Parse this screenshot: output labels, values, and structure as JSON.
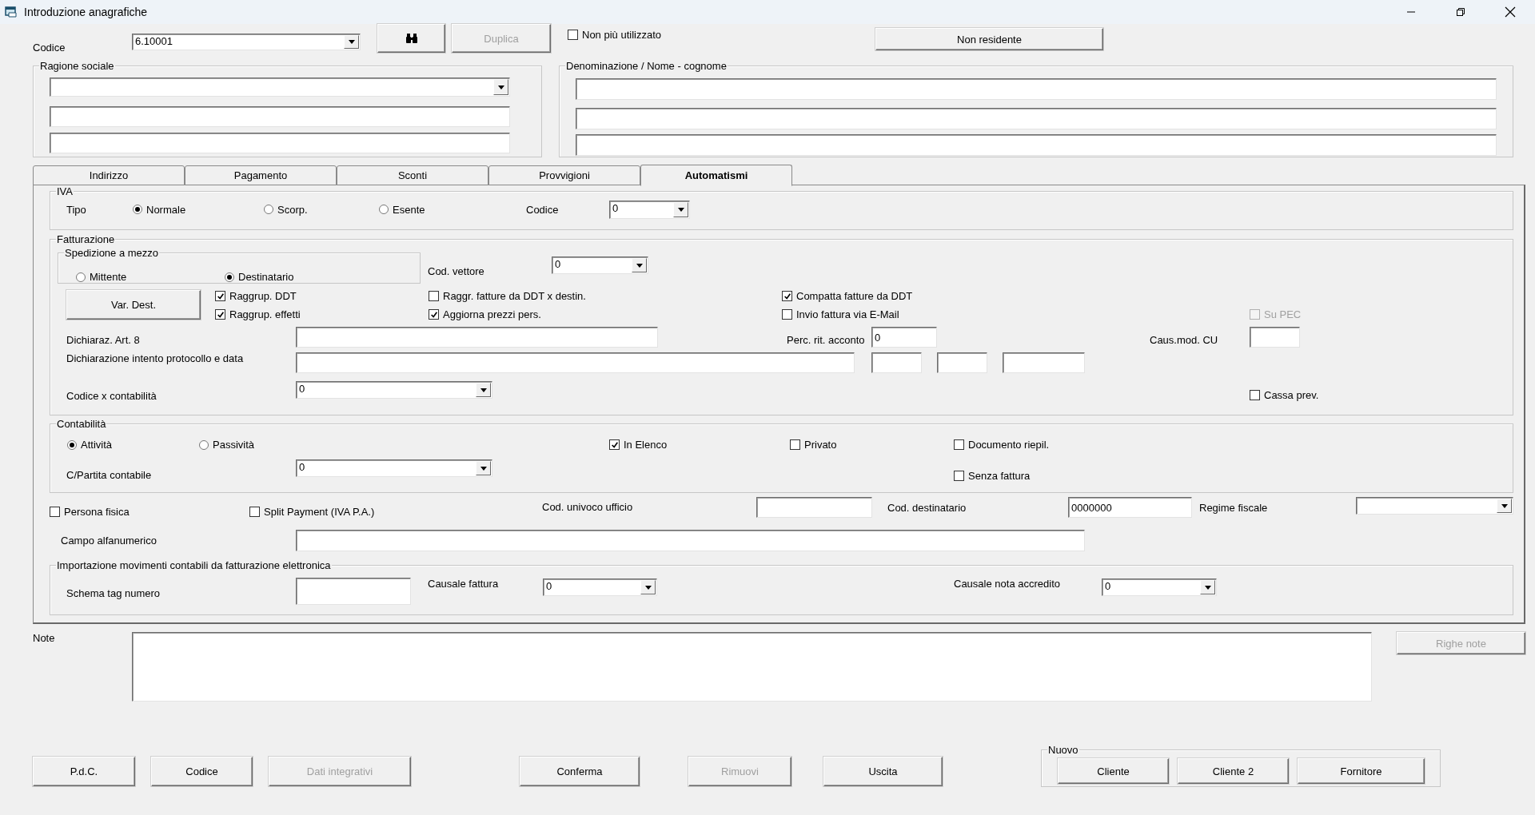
{
  "window": {
    "title": "Introduzione anagrafiche"
  },
  "header": {
    "codice_label": "Codice",
    "codice_value": "6.10001",
    "duplica": {
      "label": "Duplica",
      "disabled": true
    },
    "non_piu_utilizzato": {
      "label": "Non più utilizzato",
      "checked": false
    },
    "non_residente": "Non residente"
  },
  "ragione_sociale": {
    "title": "Ragione sociale"
  },
  "denominazione": {
    "title": "Denominazione / Nome - cognome"
  },
  "tabs": [
    {
      "label": "Indirizzo",
      "selected": false
    },
    {
      "label": "Pagamento",
      "selected": false
    },
    {
      "label": "Sconti",
      "selected": false
    },
    {
      "label": "Provvigioni",
      "selected": false
    },
    {
      "label": "Automatismi",
      "selected": true
    }
  ],
  "iva": {
    "title": "IVA",
    "tipo_label": "Tipo",
    "options": [
      {
        "label": "Normale",
        "selected": true
      },
      {
        "label": "Scorp.",
        "selected": false
      },
      {
        "label": "Esente",
        "selected": false
      }
    ],
    "codice_label": "Codice",
    "codice_value": "0"
  },
  "fatturazione": {
    "title": "Fatturazione",
    "spedizione": {
      "title": "Spedizione a mezzo",
      "options": [
        {
          "label": "Mittente",
          "selected": false
        },
        {
          "label": "Destinatario",
          "selected": true
        }
      ]
    },
    "cod_vettore_label": "Cod. vettore",
    "cod_vettore_value": "0",
    "var_dest": "Var. Dest.",
    "raggrup_ddt": {
      "label": "Raggrup. DDT",
      "checked": true
    },
    "raggrup_effetti": {
      "label": "Raggrup. effetti",
      "checked": true
    },
    "raggr_fatture": {
      "label": "Raggr. fatture da DDT x destin.",
      "checked": false
    },
    "aggiorna_prezzi": {
      "label": "Aggiorna prezzi pers.",
      "checked": true
    },
    "compatta_fatture": {
      "label": "Compatta fatture da DDT",
      "checked": true
    },
    "invio_email": {
      "label": "Invio fattura via E-Mail",
      "checked": false
    },
    "su_pec": {
      "label": "Su PEC",
      "checked": false,
      "disabled": true
    },
    "dichiaraz_label": "Dichiaraz. Art. 8",
    "perc_label": "Perc. rit. acconto",
    "perc_value": "0",
    "caus_label": "Caus.mod. CU",
    "intento_label": "Dichiarazione intento protocollo e data",
    "codice_contab_label": "Codice x contabilità",
    "codice_contab_value": "0",
    "cassa_prev": {
      "label": "Cassa prev.",
      "checked": false
    }
  },
  "contabilita": {
    "title": "Contabilità",
    "options": [
      {
        "label": "Attività",
        "selected": true
      },
      {
        "label": "Passività",
        "selected": false
      }
    ],
    "in_elenco": {
      "label": "In Elenco",
      "checked": true
    },
    "privato": {
      "label": "Privato",
      "checked": false
    },
    "documento_riepil": {
      "label": "Documento riepil.",
      "checked": false
    },
    "senza_fattura": {
      "label": "Senza fattura",
      "checked": false
    },
    "partita_label": "C/Partita contabile",
    "partita_value": "0"
  },
  "persona_fisica": {
    "label": "Persona fisica",
    "checked": false
  },
  "split_payment": {
    "label": "Split Payment (IVA P.A.)",
    "checked": false
  },
  "cod_univoco_label": "Cod. univoco ufficio",
  "cod_destinatario_label": "Cod. destinatario",
  "cod_destinatario_value": "0000000",
  "regime_fiscale_label": "Regime fiscale",
  "campo_label": "Campo alfanumerico",
  "importazione": {
    "title": "Importazione movimenti contabili da fatturazione elettronica",
    "schema_label": "Schema tag numero",
    "causale_fattura_label": "Causale fattura",
    "causale_fattura_value": "0",
    "causale_nota_label": "Causale nota accredito",
    "causale_nota_value": "0"
  },
  "note": {
    "label": "Note",
    "righe_note": {
      "label": "Righe note",
      "disabled": true
    }
  },
  "buttons": [
    {
      "label": "P.d.C.",
      "disabled": false
    },
    {
      "label": "Codice",
      "disabled": false
    },
    {
      "label": "Dati integrativi",
      "disabled": true
    },
    {
      "label": "Conferma",
      "disabled": false
    },
    {
      "label": "Rimuovi",
      "disabled": true
    },
    {
      "label": "Uscita",
      "disabled": false
    }
  ],
  "nuovo": {
    "title": "Nuovo",
    "buttons": [
      "Cliente",
      "Cliente 2",
      "Fornitore"
    ]
  }
}
